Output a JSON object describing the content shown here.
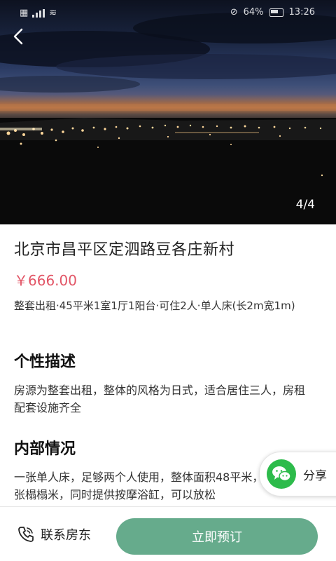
{
  "status_bar": {
    "battery": "64%",
    "time": "13:26"
  },
  "gallery": {
    "page_indicator": "4/4"
  },
  "listing": {
    "title": "北京市昌平区定泗路豆各庄新村",
    "price": "￥666.00",
    "specs": "整套出租·45平米1室1厅1阳台·可住2人·单人床(长2m宽1m)"
  },
  "sections": [
    {
      "title": "个性描述",
      "text": "房源为整套出租，整体的风格为日式，适合居住三人，房租配套设施齐全"
    },
    {
      "title": "内部情况",
      "text": "一张单人床，足够两个人使用，整体面积48平米，客厅有一张榻榻米，同时提供按摩浴缸，可以放松"
    }
  ],
  "share": {
    "label": "分享",
    "icon": "wechat-icon"
  },
  "bottom_bar": {
    "contact_label": "联系房东",
    "contact_icon": "phone-icon",
    "book_label": "立即预订"
  },
  "colors": {
    "price": "#e25566",
    "book_button": "#66ab8c",
    "wechat": "#2dbb4b"
  }
}
